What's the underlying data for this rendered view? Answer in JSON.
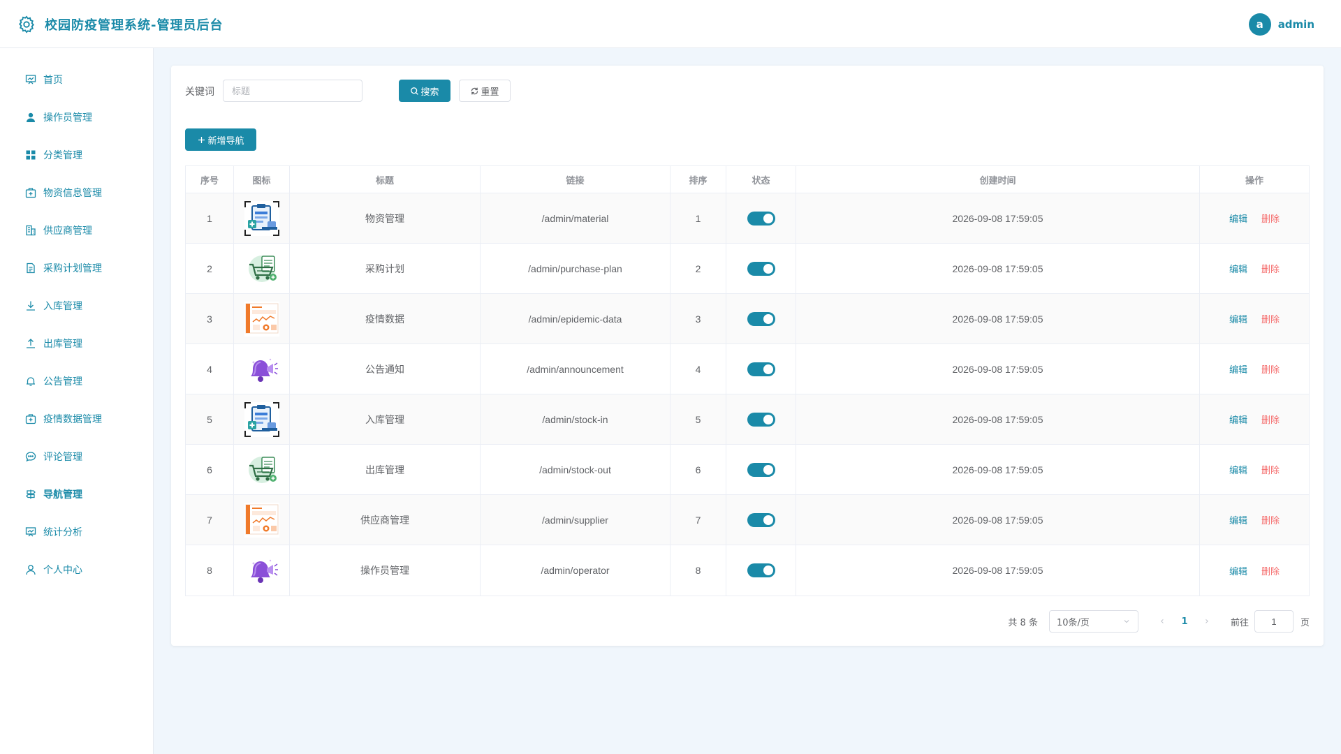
{
  "header": {
    "title": "校园防疫管理系统-管理员后台",
    "avatar_letter": "a",
    "username": "admin"
  },
  "sidebar": {
    "items": [
      {
        "label": "首页",
        "icon": "presentation-icon"
      },
      {
        "label": "操作员管理",
        "icon": "user-icon"
      },
      {
        "label": "分类管理",
        "icon": "grid-icon"
      },
      {
        "label": "物资信息管理",
        "icon": "package-icon"
      },
      {
        "label": "供应商管理",
        "icon": "building-icon"
      },
      {
        "label": "采购计划管理",
        "icon": "document-icon"
      },
      {
        "label": "入库管理",
        "icon": "download-icon"
      },
      {
        "label": "出库管理",
        "icon": "upload-icon"
      },
      {
        "label": "公告管理",
        "icon": "bell-icon"
      },
      {
        "label": "疫情数据管理",
        "icon": "medical-box-icon"
      },
      {
        "label": "评论管理",
        "icon": "chat-icon"
      },
      {
        "label": "导航管理",
        "icon": "navigation-icon"
      },
      {
        "label": "统计分析",
        "icon": "chart-icon"
      },
      {
        "label": "个人中心",
        "icon": "person-icon"
      }
    ],
    "active_index": 11
  },
  "search": {
    "label": "关键词",
    "placeholder": "标题",
    "value": "",
    "search_button": "搜索",
    "reset_button": "重置"
  },
  "add_button": "新增导航",
  "table": {
    "headers": [
      "序号",
      "图标",
      "标题",
      "链接",
      "排序",
      "状态",
      "创建时间",
      "操作"
    ],
    "rows": [
      {
        "index": "1",
        "icon": "clipboard-medical-icon",
        "title": "物资管理",
        "link": "/admin/material",
        "sort": "1",
        "enabled": true,
        "created": "2026-09-08 17:59:05"
      },
      {
        "index": "2",
        "icon": "shopping-cart-icon",
        "title": "采购计划",
        "link": "/admin/purchase-plan",
        "sort": "2",
        "enabled": true,
        "created": "2026-09-08 17:59:05"
      },
      {
        "index": "3",
        "icon": "dashboard-report-icon",
        "title": "疫情数据",
        "link": "/admin/epidemic-data",
        "sort": "3",
        "enabled": true,
        "created": "2026-09-08 17:59:05"
      },
      {
        "index": "4",
        "icon": "megaphone-bell-icon",
        "title": "公告通知",
        "link": "/admin/announcement",
        "sort": "4",
        "enabled": true,
        "created": "2026-09-08 17:59:05"
      },
      {
        "index": "5",
        "icon": "clipboard-medical-icon",
        "title": "入库管理",
        "link": "/admin/stock-in",
        "sort": "5",
        "enabled": true,
        "created": "2026-09-08 17:59:05"
      },
      {
        "index": "6",
        "icon": "shopping-cart-icon",
        "title": "出库管理",
        "link": "/admin/stock-out",
        "sort": "6",
        "enabled": true,
        "created": "2026-09-08 17:59:05"
      },
      {
        "index": "7",
        "icon": "dashboard-report-icon",
        "title": "供应商管理",
        "link": "/admin/supplier",
        "sort": "7",
        "enabled": true,
        "created": "2026-09-08 17:59:05"
      },
      {
        "index": "8",
        "icon": "megaphone-bell-icon",
        "title": "操作员管理",
        "link": "/admin/operator",
        "sort": "8",
        "enabled": true,
        "created": "2026-09-08 17:59:05"
      }
    ],
    "edit_label": "编辑",
    "delete_label": "删除"
  },
  "pagination": {
    "total_text": "共 8 条",
    "page_size": "10条/页",
    "current_page": "1",
    "goto_label": "前往",
    "goto_value": "1",
    "page_suffix": "页"
  },
  "colors": {
    "primary": "#1a8aa8",
    "danger": "#f56c6c",
    "background": "#f0f6fc"
  }
}
